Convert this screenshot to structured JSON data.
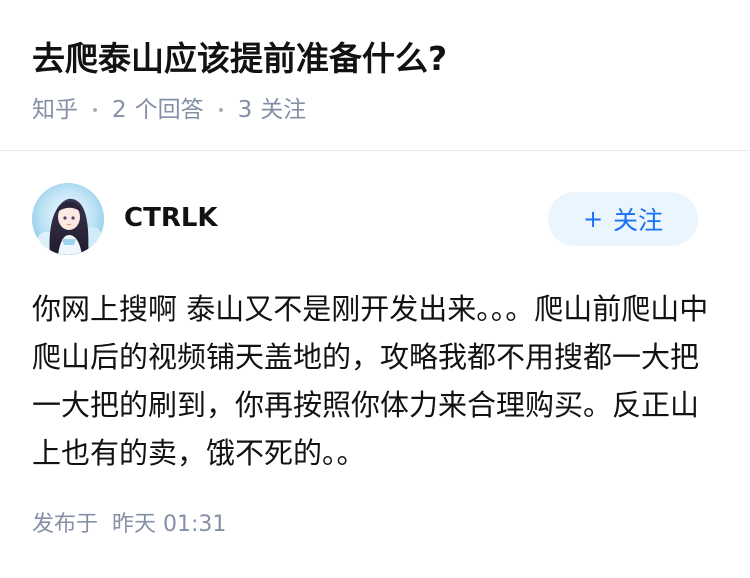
{
  "question": {
    "title": "去爬泰山应该提前准备什么?",
    "source": "知乎",
    "answer_count": "2",
    "answer_count_label": "个回答",
    "follower_count": "3",
    "follower_count_label": "关注"
  },
  "answer": {
    "author_name": "CTRLK",
    "follow_button_plus": "+",
    "follow_button_label": "关注",
    "content": "你网上搜啊 泰山又不是刚开发出来。。。爬山前爬山中爬山后的视频铺天盖地的，攻略我都不用搜都一大把一大把的刷到，你再按照你体力来合理购买。反正山上也有的卖，饿不死的。。",
    "posted_label": "发布于",
    "posted_time": "昨天 01:31"
  },
  "colors": {
    "title_text": "#121212",
    "meta_text": "#8590a6",
    "accent_blue": "#1772f6",
    "follow_button_bg": "#ebf5fd",
    "divider": "#ececec"
  },
  "icons": {
    "avatar": "anime-girl-avatar-image"
  }
}
